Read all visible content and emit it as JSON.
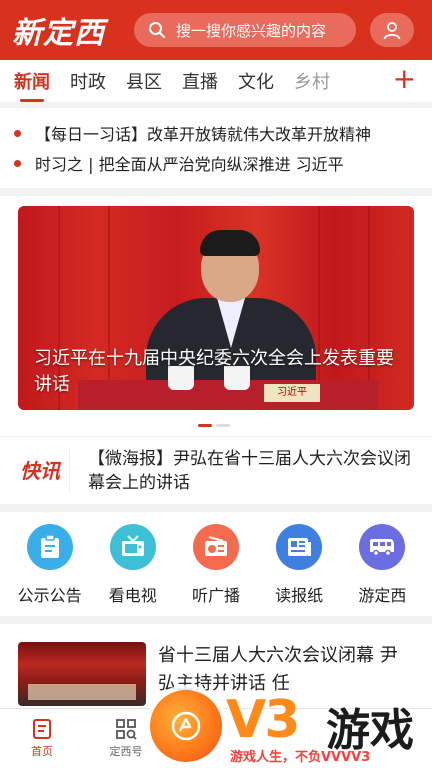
{
  "header": {
    "logo_text": "新定西",
    "search_placeholder": "搜一搜你感兴趣的内容",
    "search_icon": "search-icon",
    "user_icon": "user-icon"
  },
  "tabs": {
    "items": [
      "新闻",
      "时政",
      "县区",
      "直播",
      "文化",
      "乡村"
    ],
    "active_index": 0,
    "add_label": "+"
  },
  "headlines": [
    "【每日一习话】改革开放铸就伟大改革开放精神",
    "时习之 | 把全面从严治党向纵深推进 习近平"
  ],
  "banner": {
    "caption": "习近平在十九届中央纪委六次全会上发表重要讲话",
    "nameplate": "习近平",
    "slide_count": 2,
    "active_slide": 0
  },
  "kuaixun": {
    "logo_text": "快讯",
    "text": "【微海报】尹弘在省十三届人大六次会议闭幕会上的讲话"
  },
  "services": [
    {
      "label": "公示公告",
      "icon": "clipboard-icon",
      "color": "#3aaee8"
    },
    {
      "label": "看电视",
      "icon": "tv-icon",
      "color": "#3dbfd6"
    },
    {
      "label": "听广播",
      "icon": "radio-icon",
      "color": "#f26b4c"
    },
    {
      "label": "读报纸",
      "icon": "newspaper-icon",
      "color": "#3f7fe0"
    },
    {
      "label": "游定西",
      "icon": "bus-icon",
      "color": "#6b6de0"
    }
  ],
  "news_card": {
    "title": "省十三届人大六次会议闭幕 尹弘主持并讲话 任"
  },
  "bottom_nav": [
    {
      "label": "首页",
      "icon": "home-icon",
      "active": true
    },
    {
      "label": "定西号",
      "icon": "grid-search-icon",
      "active": false
    }
  ],
  "watermark": {
    "brand": "V3",
    "brand_cn": "游戏",
    "slogan": "游戏人生，不负VVVV3"
  },
  "colors": {
    "brand_red": "#d8321f",
    "watermark_orange": "#ff8a1a"
  }
}
